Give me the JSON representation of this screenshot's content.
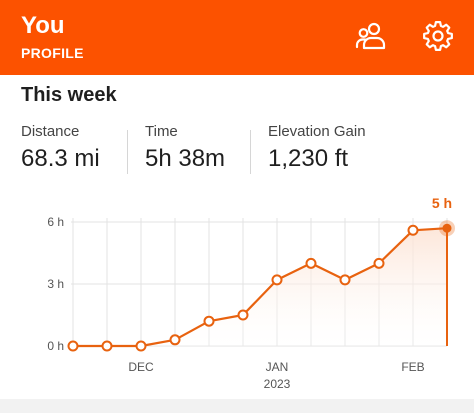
{
  "header": {
    "title": "You",
    "subtitle": "PROFILE",
    "friends_icon": "people-icon",
    "settings_icon": "gear-icon",
    "bg_color": "#fc5200"
  },
  "week": {
    "title": "This week"
  },
  "stats": [
    {
      "label": "Distance",
      "value": "68.3 mi"
    },
    {
      "label": "Time",
      "value": "5h 38m"
    },
    {
      "label": "Elevation Gain",
      "value": "1,230 ft"
    }
  ],
  "chart_data": {
    "type": "line",
    "title": "",
    "xlabel": "",
    "ylabel": "",
    "ylim": [
      0,
      6
    ],
    "yticks": [
      "6 h",
      "3 h",
      "0 h"
    ],
    "ytick_values": [
      6,
      3,
      0
    ],
    "x": [
      1,
      2,
      3,
      4,
      5,
      6,
      7,
      8,
      9,
      10,
      11,
      12
    ],
    "x_tick_labels": [
      "DEC",
      "JAN",
      "FEB"
    ],
    "x_tick_positions": [
      3,
      7,
      11
    ],
    "x_sublabel": "2023",
    "series": [
      {
        "values": [
          0,
          0,
          0,
          0.3,
          1.2,
          1.5,
          3.2,
          4,
          3.2,
          4,
          5.6,
          5.7
        ]
      }
    ],
    "highlight_label": "5 h",
    "line_color": "#e8620f",
    "fill_color": "#fce2d3",
    "grid": true
  }
}
